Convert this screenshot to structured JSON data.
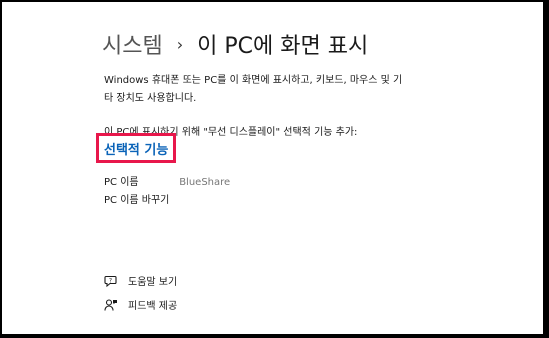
{
  "breadcrumb": {
    "parent": "시스템",
    "separator": "›",
    "current": "이 PC에 화면 표시"
  },
  "description": "Windows 휴대폰 또는 PC를 이 화면에 표시하고, 키보드, 마우스 및 기타 장치도 사용합니다.",
  "wireless_hint": "이 PC에 표시하기 위해 \"무선 디스플레이\" 선택적 기능 추가:",
  "optional_features_link": "선택적 기능",
  "pc_name": {
    "label": "PC 이름",
    "value": "BlueShare"
  },
  "rename_link": "PC 이름 바꾸기",
  "footer": {
    "help_label": "도움말 보기",
    "feedback_label": "피드백 제공"
  },
  "colors": {
    "link": "#0a63b8",
    "highlight": "#e8174b"
  },
  "icons": {
    "help": "help-icon",
    "feedback": "feedback-icon"
  }
}
